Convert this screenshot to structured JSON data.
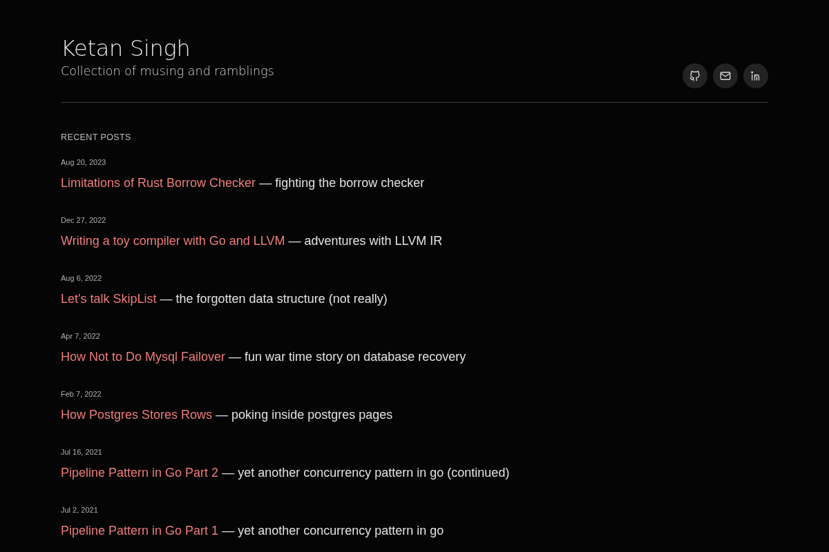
{
  "header": {
    "title": "Ketan Singh",
    "subtitle": "Collection of musing and ramblings",
    "social_links": [
      {
        "kind": "github"
      },
      {
        "kind": "mail"
      },
      {
        "kind": "linkedin"
      }
    ]
  },
  "recent_posts": {
    "heading": "RECENT POSTS",
    "posts": [
      {
        "date": "Aug 20, 2023",
        "title": "Limitations of Rust Borrow Checker",
        "description": "— fighting the borrow checker"
      },
      {
        "date": "Dec 27, 2022",
        "title": "Writing a toy compiler with Go and LLVM",
        "description": "— adventures with LLVM IR"
      },
      {
        "date": "Aug 6, 2022",
        "title": "Let's talk SkipList",
        "description": "— the forgotten data structure (not really)"
      },
      {
        "date": "Apr 7, 2022",
        "title": "How Not to Do Mysql Failover",
        "description": "— fun war time story on database recovery"
      },
      {
        "date": "Feb 7, 2022",
        "title": "How Postgres Stores Rows",
        "description": "— poking inside postgres pages"
      },
      {
        "date": "Jul 16, 2021",
        "title": "Pipeline Pattern in Go Part 2",
        "description": "— yet another concurrency pattern in go (continued)"
      },
      {
        "date": "Jul 2, 2021",
        "title": "Pipeline Pattern in Go Part 1",
        "description": "— yet another concurrency pattern in go"
      }
    ]
  }
}
